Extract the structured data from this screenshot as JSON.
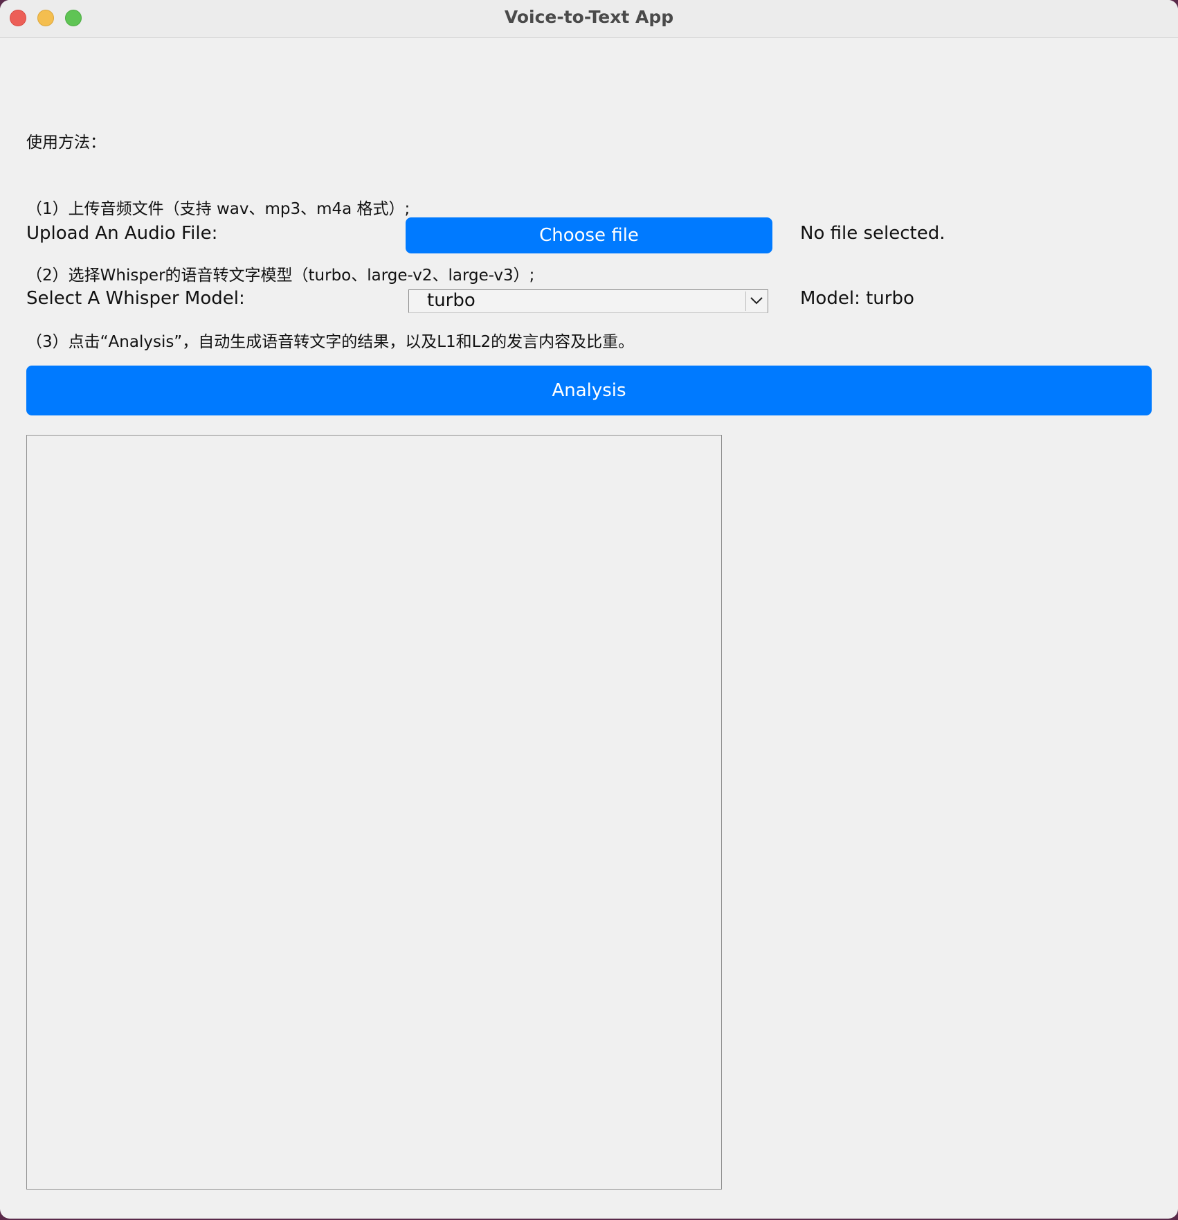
{
  "window": {
    "title": "Voice-to-Text App"
  },
  "instructions": {
    "heading": "使用方法：",
    "steps": [
      "（1）上传音频文件（支持 wav、mp3、m4a 格式）;",
      "（2）选择Whisper的语音转文字模型（turbo、large-v2、large-v3）;",
      "（3）点击“Analysis”，自动生成语音转文字的结果，以及L1和L2的发言内容及比重。"
    ]
  },
  "upload": {
    "label": "Upload An Audio File:",
    "button_label": "Choose file",
    "status": "No file selected."
  },
  "model": {
    "label": "Select A Whisper Model:",
    "selected": "turbo",
    "status": "Model: turbo"
  },
  "analysis": {
    "button_label": "Analysis"
  },
  "output": {
    "text": ""
  },
  "colors": {
    "accent": "#007aff",
    "window_bg": "#f0f0f0"
  }
}
